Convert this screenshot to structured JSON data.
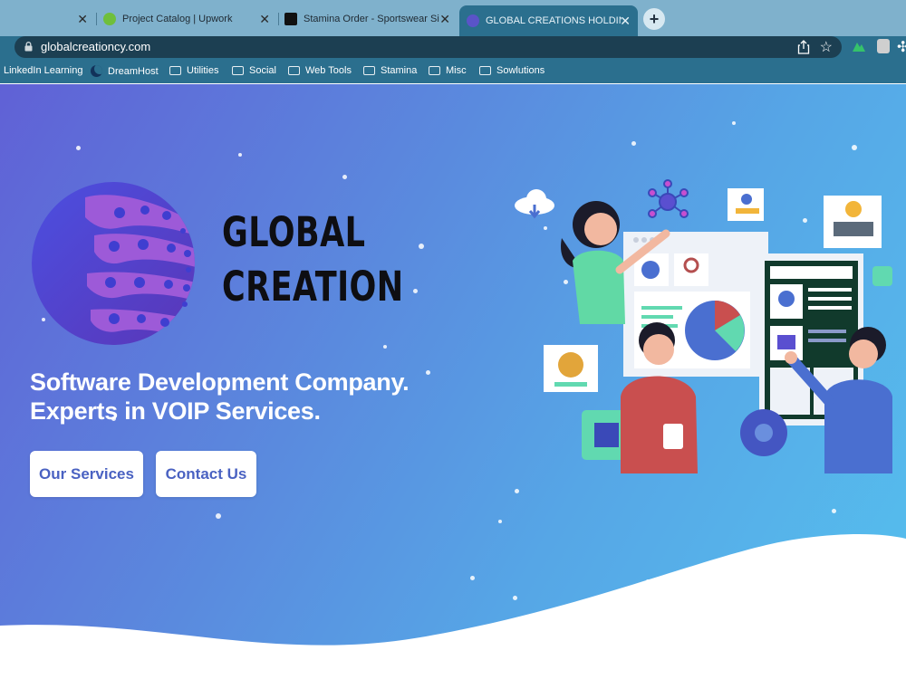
{
  "browser": {
    "tabs": [
      {
        "title": "",
        "active": false
      },
      {
        "title": "Project Catalog | Upwork",
        "active": false
      },
      {
        "title": "Stamina Order - Sportswear Si",
        "active": false
      },
      {
        "title": "GLOBAL CREATIONS HOLDING",
        "active": true
      }
    ],
    "new_tab": "+",
    "url": "globalcreationcy.com",
    "bookmarks": [
      {
        "label": "LinkedIn Learning",
        "icon": "none"
      },
      {
        "label": "DreamHost",
        "icon": "dreamhost-icon"
      },
      {
        "label": "Utilities",
        "icon": "folder-icon"
      },
      {
        "label": "Social",
        "icon": "folder-icon"
      },
      {
        "label": "Web Tools",
        "icon": "folder-icon"
      },
      {
        "label": "Stamina",
        "icon": "folder-icon"
      },
      {
        "label": "Misc",
        "icon": "folder-icon"
      },
      {
        "label": "Sowlutions",
        "icon": "folder-icon"
      }
    ]
  },
  "hero": {
    "brand_line1": "GLOBAL",
    "brand_line2": "CREATION",
    "headline_line1": "Software Development Company.",
    "headline_line2": "Experts in VOIP Services.",
    "buttons": {
      "services": "Our Services",
      "contact": "Contact Us"
    }
  },
  "colors": {
    "gradient_start": "#6061d6",
    "gradient_end": "#55c0ee",
    "button_text": "#4a62c2",
    "chrome": "#2b6f8e"
  }
}
